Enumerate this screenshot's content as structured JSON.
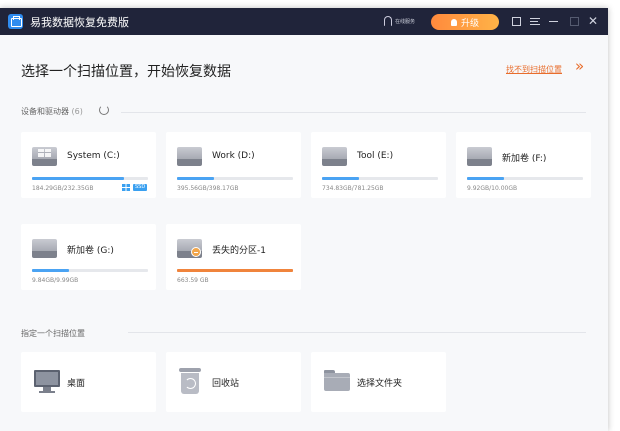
{
  "app": {
    "title": "易我数据恢复免费版",
    "online_service": "在线服务",
    "upgrade_label": "升级"
  },
  "header": {
    "heading": "选择一个扫描位置，开始恢复数据",
    "help_link": "找不到扫描位置",
    "help_chevron": "»"
  },
  "devices": {
    "label": "设备和驱动器",
    "count": "(6)",
    "drives": [
      {
        "name": "System (C:)",
        "size": "184.29GB/232.35GB",
        "usage": 0.79,
        "system": true
      },
      {
        "name": "Work (D:)",
        "size": "395.56GB/398.17GB",
        "usage": 0.32
      },
      {
        "name": "Tool (E:)",
        "size": "734.83GB/781.25GB",
        "usage": 0.32
      },
      {
        "name": "新加卷 (F:)",
        "size": "9.92GB/10.00GB",
        "usage": 0.32
      },
      {
        "name": "新加卷 (G:)",
        "size": "9.84GB/9.99GB",
        "usage": 0.32
      },
      {
        "name": "丢失的分区-1",
        "size": "663.59 GB",
        "usage": 1.0,
        "lost": true
      }
    ],
    "ssd_badge": "SSD"
  },
  "locations": {
    "label": "指定一个扫描位置",
    "items": [
      {
        "name": "桌面",
        "icon": "desktop-icon"
      },
      {
        "name": "回收站",
        "icon": "recycle-bin-icon"
      },
      {
        "name": "选择文件夹",
        "icon": "folder-icon"
      }
    ]
  },
  "colors": {
    "titlebar": "#20243a",
    "accent_blue": "#4aa3f3",
    "accent_orange": "#f0843c",
    "link": "#e86d2c"
  }
}
